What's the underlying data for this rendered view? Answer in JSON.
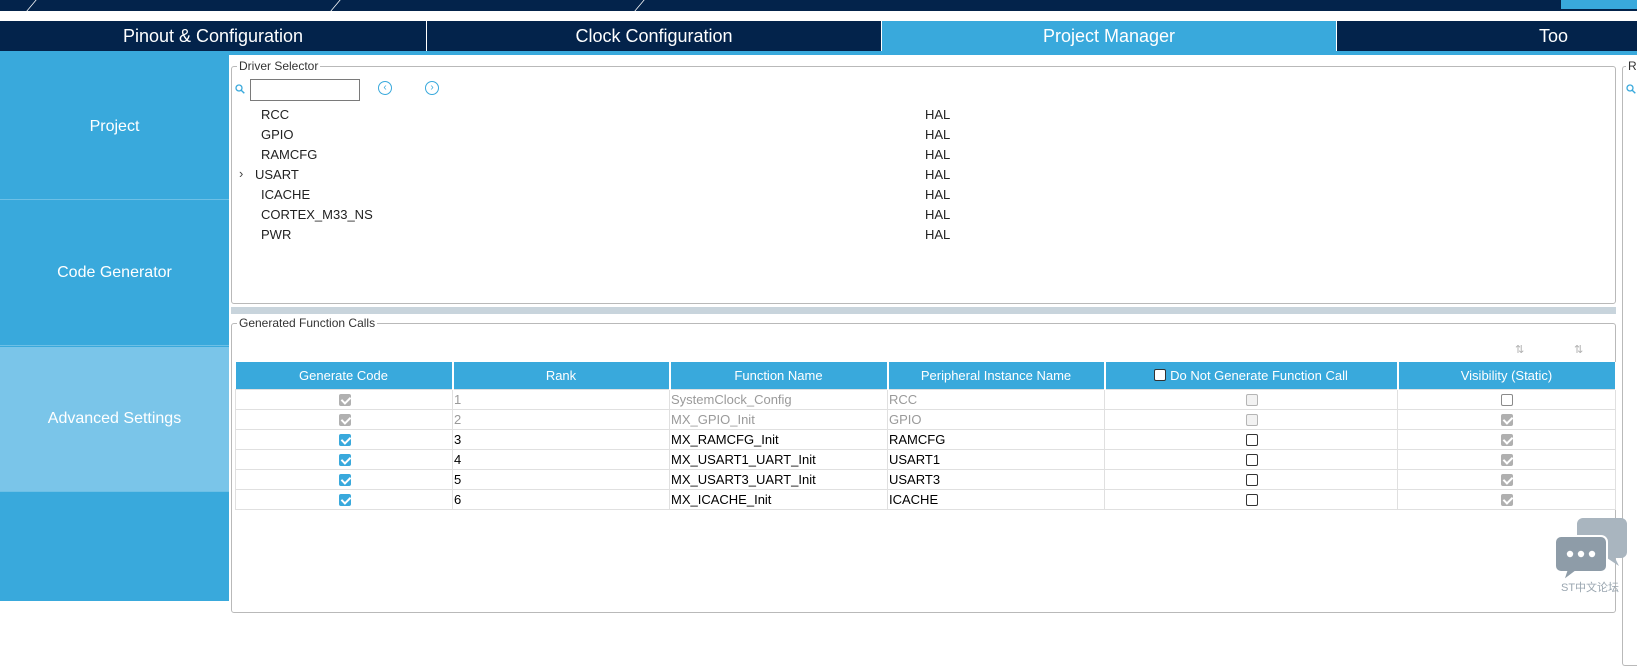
{
  "top_tabs": [
    {
      "label": "Pinout & Configuration",
      "active": false
    },
    {
      "label": "Clock Configuration",
      "active": false
    },
    {
      "label": "Project Manager",
      "active": true
    },
    {
      "label": "Too",
      "active": false
    }
  ],
  "sidebar": {
    "items": [
      {
        "label": "Project",
        "active": false
      },
      {
        "label": "Code Generator",
        "active": false
      },
      {
        "label": "Advanced Settings",
        "active": true
      },
      {
        "label": "",
        "active": false
      }
    ]
  },
  "driver_selector": {
    "title": "Driver Selector",
    "search_value": "",
    "rows": [
      {
        "name": "RCC",
        "driver": "HAL",
        "expandable": false
      },
      {
        "name": "GPIO",
        "driver": "HAL",
        "expandable": false
      },
      {
        "name": "RAMCFG",
        "driver": "HAL",
        "expandable": false
      },
      {
        "name": "USART",
        "driver": "HAL",
        "expandable": true
      },
      {
        "name": "ICACHE",
        "driver": "HAL",
        "expandable": false
      },
      {
        "name": "CORTEX_M33_NS",
        "driver": "HAL",
        "expandable": false
      },
      {
        "name": "PWR",
        "driver": "HAL",
        "expandable": false
      }
    ]
  },
  "right_panel": {
    "title_fragment": "R"
  },
  "generated_calls": {
    "title": "Generated Function Calls",
    "columns": [
      "Generate Code",
      "Rank",
      "Function Name",
      "Peripheral Instance Name",
      "Do Not Generate Function Call",
      "Visibility (Static)"
    ],
    "rows": [
      {
        "generate": true,
        "rank": "1",
        "function": "SystemClock_Config",
        "instance": "RCC",
        "do_not_generate": false,
        "visibility": false,
        "disabled": true
      },
      {
        "generate": true,
        "rank": "2",
        "function": "MX_GPIO_Init",
        "instance": "GPIO",
        "do_not_generate": false,
        "visibility": true,
        "disabled": true
      },
      {
        "generate": true,
        "rank": "3",
        "function": "MX_RAMCFG_Init",
        "instance": "RAMCFG",
        "do_not_generate": false,
        "visibility": true,
        "disabled": false
      },
      {
        "generate": true,
        "rank": "4",
        "function": "MX_USART1_UART_Init",
        "instance": "USART1",
        "do_not_generate": false,
        "visibility": true,
        "disabled": false
      },
      {
        "generate": true,
        "rank": "5",
        "function": "MX_USART3_UART_Init",
        "instance": "USART3",
        "do_not_generate": false,
        "visibility": true,
        "disabled": false
      },
      {
        "generate": true,
        "rank": "6",
        "function": "MX_ICACHE_Init",
        "instance": "ICACHE",
        "do_not_generate": false,
        "visibility": true,
        "disabled": false
      }
    ]
  },
  "chat_widget": {
    "label": "ST中文论坛"
  },
  "colors": {
    "navy": "#03234b",
    "accent": "#39a9dc",
    "active_side": "#7ac5e9"
  },
  "icons": {
    "search": "search-icon",
    "prev": "circle-left-icon",
    "next": "circle-right-icon",
    "expand": "chevron-right-icon",
    "sort_up": "sort-ascending-icon",
    "sort_down": "sort-descending-icon",
    "chat": "chat-bubble-icon"
  }
}
